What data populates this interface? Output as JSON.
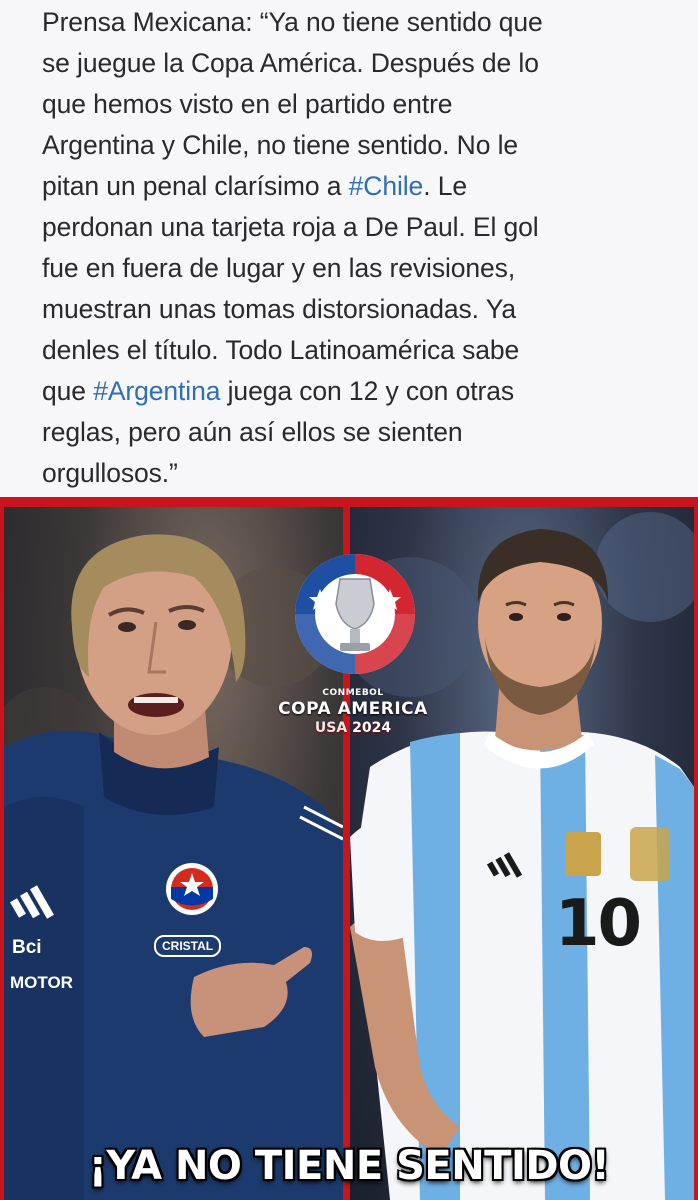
{
  "post": {
    "lines": [
      [
        "Prensa Mexicana: “Ya no tiene sentido que"
      ],
      [
        "se juegue la Copa América. Después de lo"
      ],
      [
        "que hemos visto en el partido entre"
      ],
      [
        "Argentina y Chile, no tiene sentido. No le"
      ],
      [
        "pitan un penal clarísimo a ",
        "#Chile",
        ". Le"
      ],
      [
        "perdonan una tarjeta roja a De Paul. El gol"
      ],
      [
        "fue en fuera de lugar y en las revisiones,"
      ],
      [
        "muestran unas tomas distorsionadas. Ya"
      ],
      [
        "denles el título. Todo Latinoamérica sabe"
      ],
      [
        "que ",
        "#Argentina",
        " juega con 12 y con otras"
      ],
      [
        "reglas, pero aún así ellos se sienten"
      ],
      [
        "orgullosos.”"
      ]
    ]
  },
  "meme": {
    "logo": {
      "org": "CONMEBOL",
      "name": "COPA AMERICA",
      "host": "USA",
      "year": "2024"
    },
    "left_jacket": {
      "sponsor1": "Bci",
      "sponsor2": "MOTOR",
      "sponsor3": "CRISTAL"
    },
    "right_shirt": {
      "number": "10"
    },
    "tagline": "¡YA NO TIENE SENTIDO!"
  },
  "colors": {
    "hashtag": "#2f6fb3",
    "frame_red": "#c8141c",
    "argentina_sky": "#6fb0e4",
    "chile_navy": "#1d3a6e"
  }
}
